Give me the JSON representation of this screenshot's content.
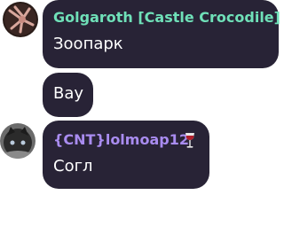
{
  "messages": [
    {
      "author": "Golgaroth [Castle Crocodile]",
      "author_color": "#6fe0b8",
      "text": "Зоопарк",
      "avatar": "creature-avatar-icon"
    },
    {
      "text": "Вау"
    },
    {
      "author": "{CNT}lolmoap12",
      "author_color": "#a98cf0",
      "author_badge": "wine-glass-icon",
      "text": "Согл",
      "avatar": "cat-avatar-icon"
    }
  ],
  "colors": {
    "bubble": "#282336",
    "text": "#ffffff"
  }
}
